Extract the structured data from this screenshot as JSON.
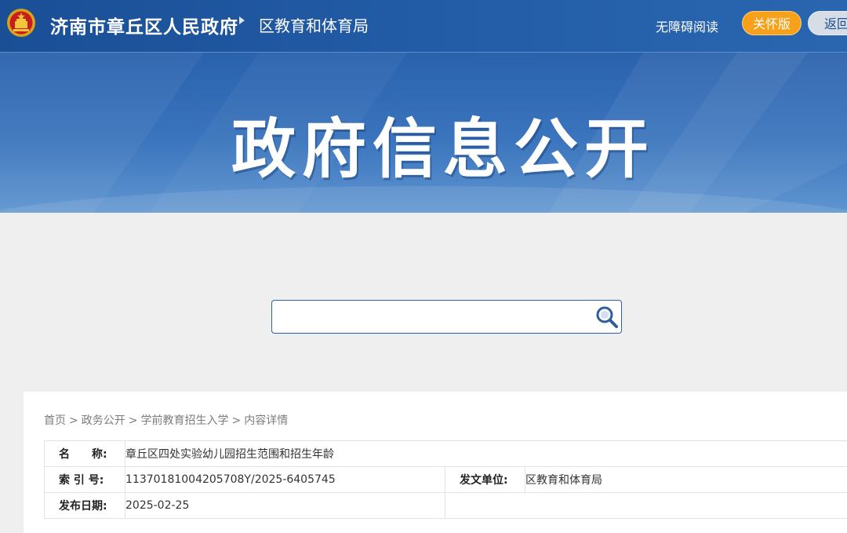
{
  "header": {
    "site_name": "济南市章丘区人民政府",
    "dept_name": "区教育和体育局",
    "accessibility_label": "无障碍阅读",
    "care_mode_label": "关怀版",
    "back_label": "返回"
  },
  "banner": {
    "title": "政府信息公开"
  },
  "search": {
    "value": "",
    "placeholder": ""
  },
  "breadcrumb": [
    "首页",
    "政务公开",
    "学前教育招生入学",
    "内容详情"
  ],
  "breadcrumb_sep": ">",
  "info": {
    "name_label": "名　　称:",
    "name_value": "章丘区四处实验幼儿园招生范围和招生年龄",
    "index_label": "索 引 号:",
    "index_value": "11370181004205708Y/2025-6405745",
    "issuer_label": "发文单位:",
    "issuer_value": "区教育和体育局",
    "date_label": "发布日期:",
    "date_value": "2025-02-25"
  },
  "colors": {
    "header_blue": "#1a4f96",
    "care_orange": "#f7a11b",
    "search_border": "#2c5fa6"
  },
  "icons": {
    "emblem": "national-emblem-icon",
    "search": "search-icon",
    "separator": "triangle-right-icon"
  }
}
